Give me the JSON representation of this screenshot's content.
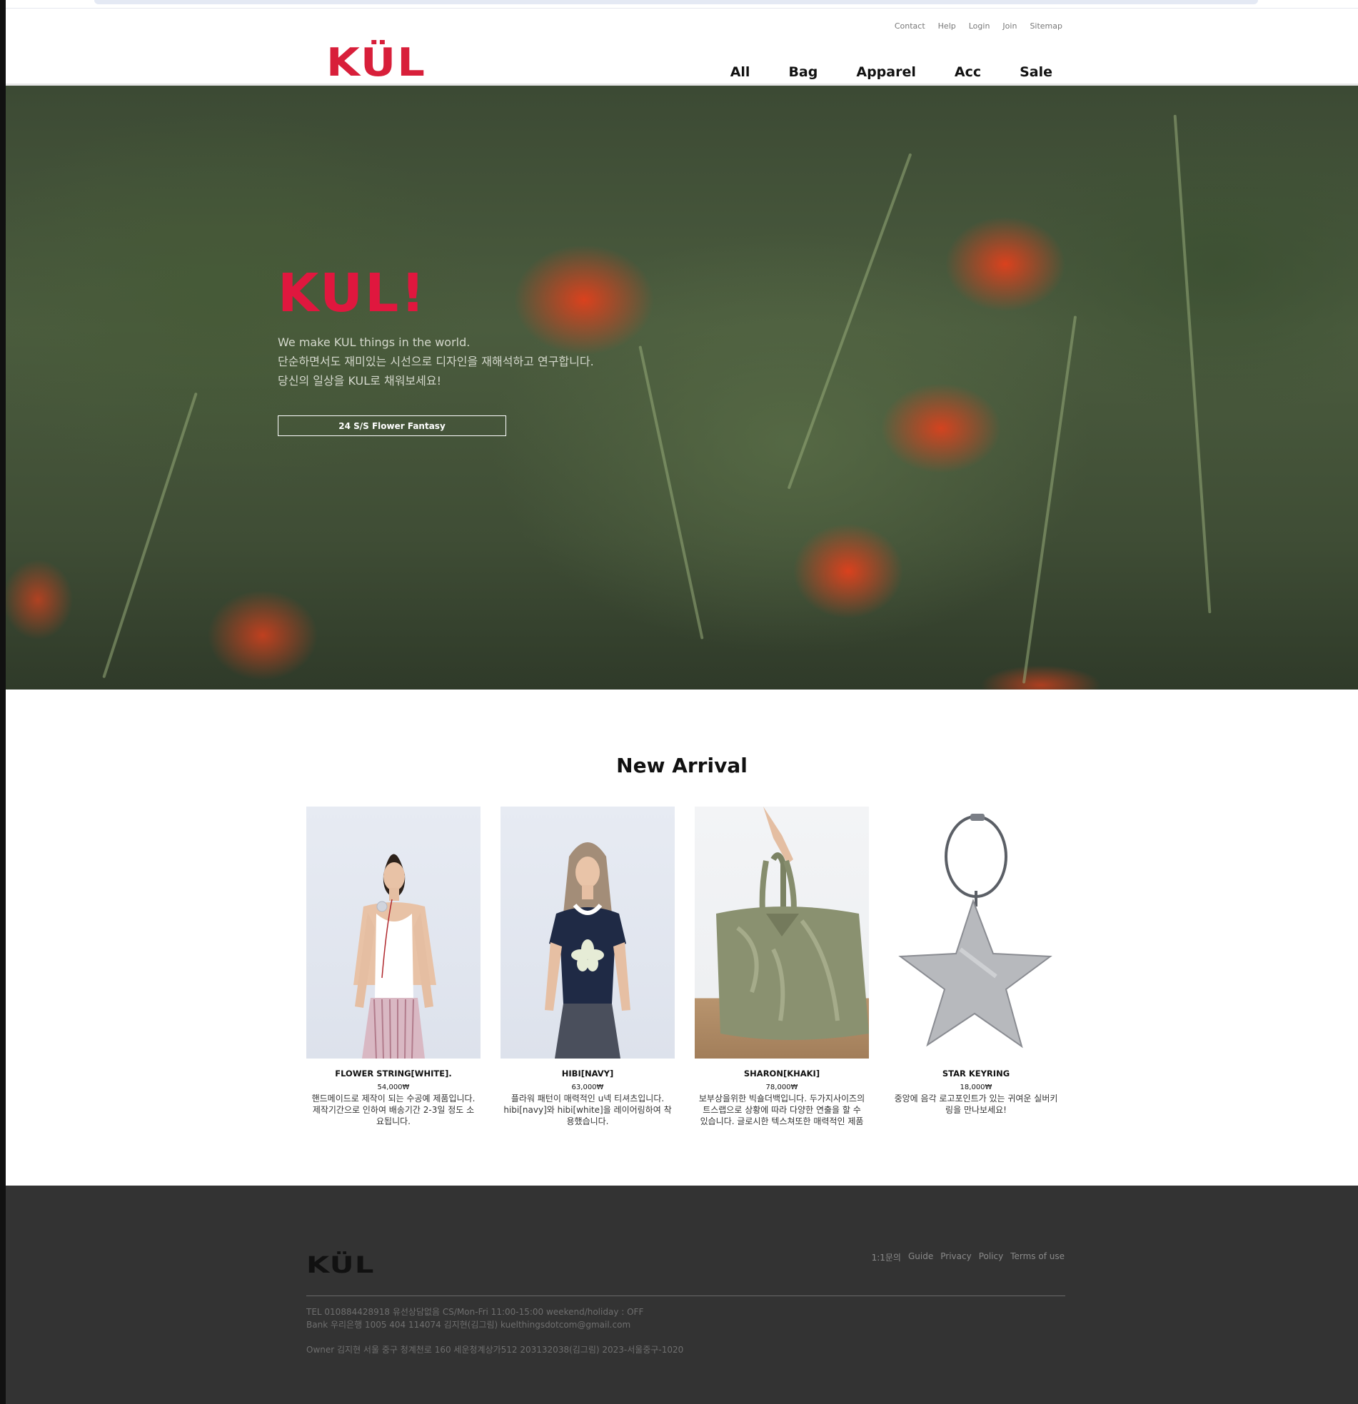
{
  "brand": {
    "logo": "KÜL",
    "accent": "#d81f3a"
  },
  "util_nav": [
    "Contact",
    "Help",
    "Login",
    "Join",
    "Sitemap"
  ],
  "main_nav": [
    "All",
    "Bag",
    "Apparel",
    "Acc",
    "Sale"
  ],
  "hero": {
    "title": "KUL!",
    "lines": [
      "We make KUL things in the world.",
      "단순하면서도 재미있는 시선으로 디자인을 재해석하고 연구합니다.",
      "당신의 일상을 KUL로 채워보세요!"
    ],
    "button": "24 S/S Flower Fantasy"
  },
  "section_title": "New Arrival",
  "products": [
    {
      "name": "FLOWER STRING[WHITE].",
      "price": "54,000₩",
      "desc": "핸드메이드로 제작이 되는 수공예 제품입니다. 제작기간으로 인하여 배송기간 2-3일 정도 소요됩니다."
    },
    {
      "name": "HIBI[NAVY]",
      "price": "63,000₩",
      "desc": "플라워 패턴이 매력적인 u넥 티셔츠입니다. hibi[navy]와 hibi[white]을 레이어링하여 착용했습니다."
    },
    {
      "name": "SHARON[KHAKI]",
      "price": "78,000₩",
      "desc": "보부상을위한 빅숄더백입니다. 두가지사이즈의 트스랩으로 상황에 따라 다양한 연출을 할 수 있습니다. 글로시한 텍스쳐또한 매력적인 제품"
    },
    {
      "name": "STAR KEYRING",
      "price": "18,000₩",
      "desc": "중앙에 음각 로고포인트가 있는 귀여운 실버키링을 만나보세요!"
    }
  ],
  "footer": {
    "logo": "KÜL",
    "links": [
      "1:1문의",
      "Guide",
      "Privacy",
      "Policy",
      "Terms of use"
    ],
    "info": [
      "TEL 010884428918 유선상담없음 CS/Mon-Fri 11:00-15:00 weekend/holiday : OFF",
      "Bank 우리은행 1005 404 114074 김지현(김그림) kuelthingsdotcom@gmail.com"
    ],
    "owner": "Owner 김지현 서울 중구 청계천로 160 세운청계상가512 203132038(김그림) 2023-서울중구-1020"
  }
}
